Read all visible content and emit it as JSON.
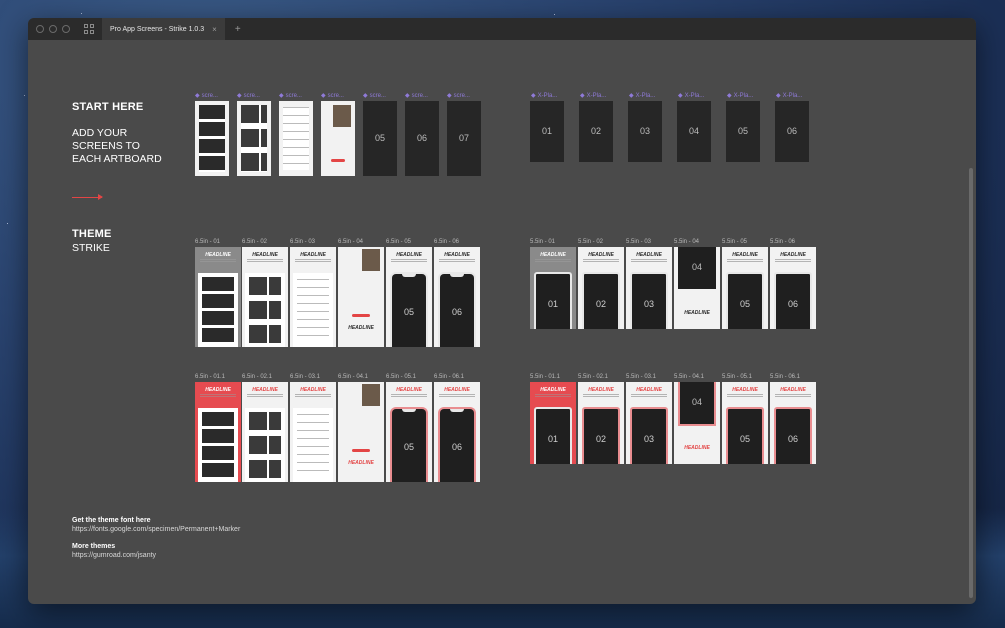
{
  "window": {
    "tab_title": "Pro App Screens - Strike 1.0.3",
    "tab_close": "×",
    "new_tab": "+"
  },
  "start": {
    "title": "START HERE",
    "text_lines": [
      "ADD YOUR",
      "SCREENS TO",
      "EACH ARTBOARD"
    ]
  },
  "theme": {
    "title": "THEME",
    "name": "STRIKE"
  },
  "footer": {
    "font_heading": "Get the theme font here",
    "font_url": "https://fonts.google.com/specimen/Permanent+Marker",
    "more_heading": "More themes",
    "more_url": "https://gumroad.com/jsanty"
  },
  "screens_left_labels": [
    "scre...",
    "scre...",
    "scre...",
    "scre...",
    "scre...",
    "scre...",
    "scre..."
  ],
  "screens_left_numbers": [
    "05",
    "06",
    "07"
  ],
  "screens_right_labels": [
    "X-Pla...",
    "X-Pla...",
    "X-Pla...",
    "X-Pla...",
    "X-Pla...",
    "X-Pla..."
  ],
  "screens_right_numbers": [
    "01",
    "02",
    "03",
    "04",
    "05",
    "06"
  ],
  "row2_left_labels": [
    "6.5in - 01",
    "6.5in - 02",
    "6.5in - 03",
    "6.5in - 04",
    "6.5in - 05",
    "6.5in - 06"
  ],
  "row2_right_labels": [
    "5.5in - 01",
    "5.5in - 02",
    "5.5in - 03",
    "5.5in - 04",
    "5.5in - 05",
    "5.5in - 06"
  ],
  "row3_left_labels": [
    "6.5in - 01.1",
    "6.5in - 02.1",
    "6.5in - 03.1",
    "6.5in - 04.1",
    "6.5in - 05.1",
    "6.5in - 06.1"
  ],
  "row3_right_labels": [
    "5.5in - 01.1",
    "5.5in - 02.1",
    "5.5in - 03.1",
    "5.5in - 04.1",
    "5.5in - 05.1",
    "5.5in - 06.1"
  ],
  "headline": "HEADLINE",
  "numbers": [
    "01",
    "02",
    "03",
    "04",
    "05",
    "06"
  ],
  "colors": {
    "accent": "#e34545",
    "artboard_label_purple": "#8f7ad8",
    "canvas": "#4a4a4a",
    "titlebar": "#2b2b2b"
  }
}
